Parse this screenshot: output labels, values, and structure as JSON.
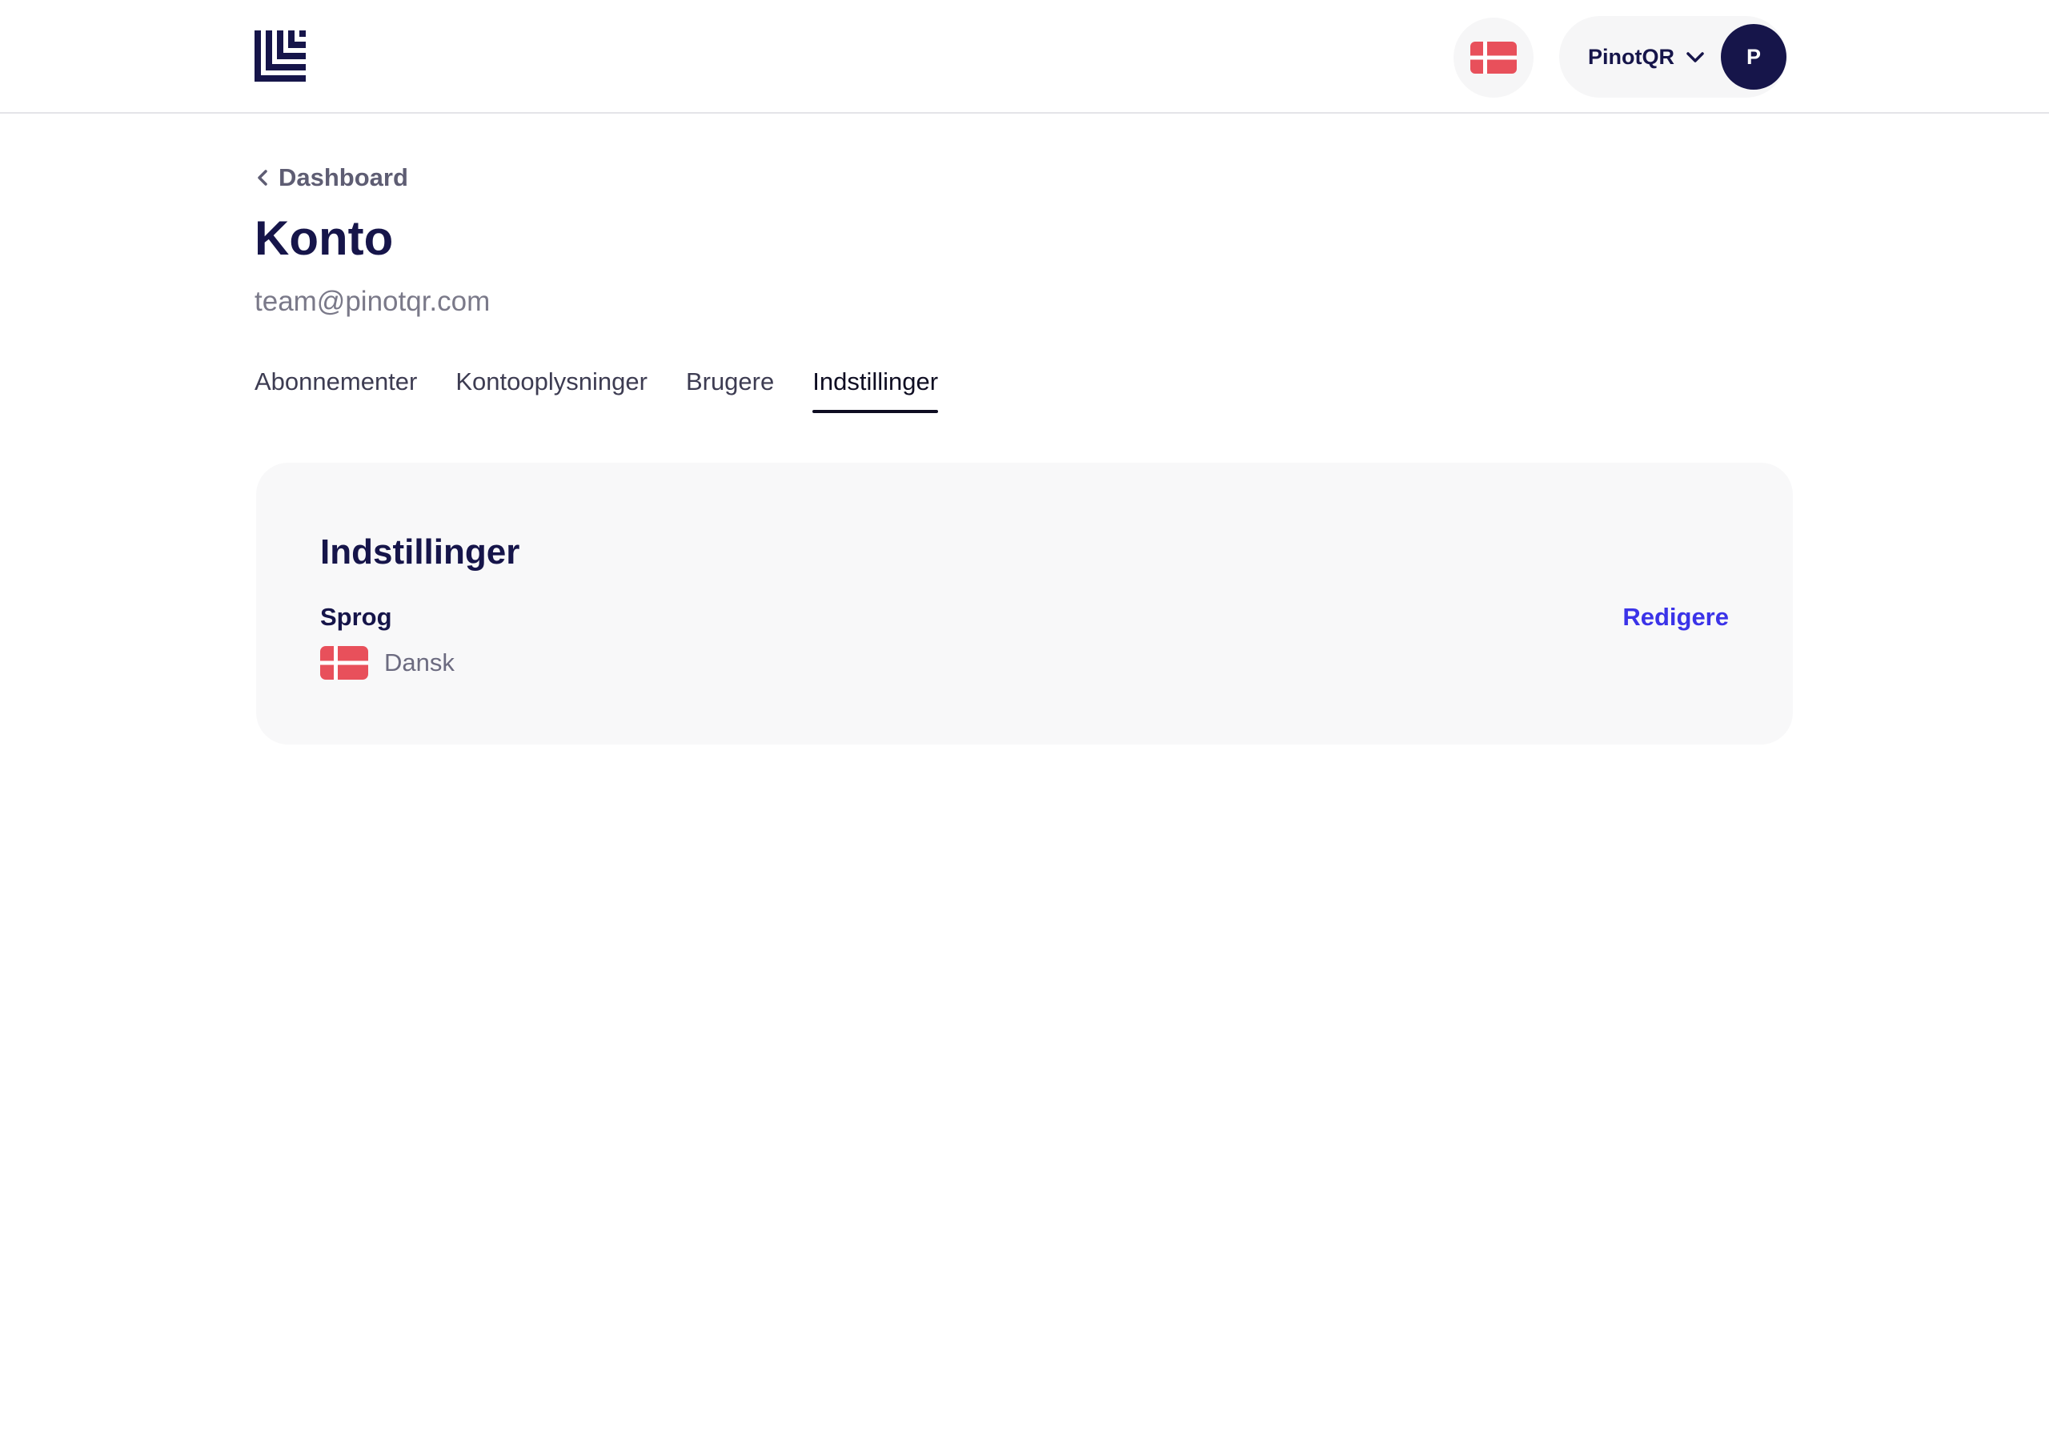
{
  "header": {
    "logo_icon": "brand-logo-icon",
    "language_flag_icon": "denmark-flag-icon",
    "account": {
      "name": "PinotQR",
      "avatar_initial": "P",
      "chevron_icon": "chevron-down-icon"
    }
  },
  "page": {
    "back_link": "Dashboard",
    "title": "Konto",
    "email": "team@pinotqr.com"
  },
  "tabs": [
    {
      "label": "Abonnementer",
      "active": false
    },
    {
      "label": "Kontooplysninger",
      "active": false
    },
    {
      "label": "Brugere",
      "active": false
    },
    {
      "label": "Indstillinger",
      "active": true
    }
  ],
  "settings_card": {
    "title": "Indstillinger",
    "language": {
      "label": "Sprog",
      "value": "Dansk",
      "flag_icon": "denmark-flag-icon",
      "edit_label": "Redigere"
    }
  },
  "colors": {
    "brand_navy": "#16154a",
    "flag_red": "#e8505b",
    "link_blue": "#3b33e8",
    "card_background": "#f8f8f9"
  }
}
